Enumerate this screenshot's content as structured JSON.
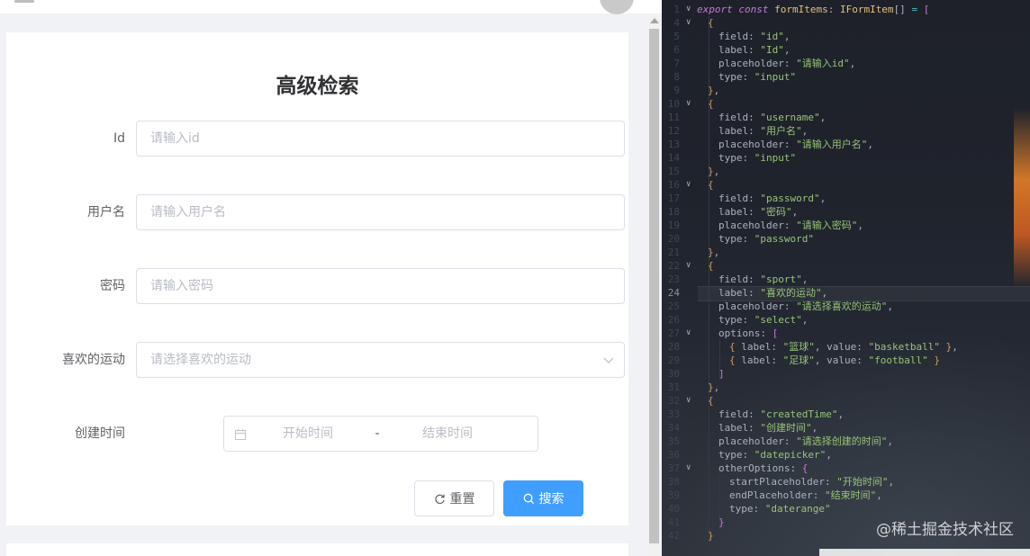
{
  "form": {
    "title": "高级检索",
    "fields": [
      {
        "label": "Id",
        "placeholder": "请输入id"
      },
      {
        "label": "用户名",
        "placeholder": "请输入用户名"
      },
      {
        "label": "密码",
        "placeholder": "请输入密码"
      },
      {
        "label": "喜欢的运动",
        "placeholder": "请选择喜欢的运动"
      },
      {
        "label": "创建时间",
        "start_placeholder": "开始时间",
        "separator": "-",
        "end_placeholder": "结束时间"
      }
    ],
    "reset_label": "重置",
    "search_label": "搜索"
  },
  "code": {
    "line_numbers": [
      "1",
      "4",
      "5",
      "6",
      "7",
      "8",
      "9",
      "10",
      "11",
      "12",
      "13",
      "14",
      "15",
      "16",
      "17",
      "18",
      "19",
      "20",
      "21",
      "22",
      "23",
      "24",
      "25",
      "26",
      "27",
      "28",
      "29",
      "30",
      "31",
      "32",
      "33",
      "34",
      "35",
      "36",
      "37",
      "38",
      "39",
      "40",
      "41",
      "42"
    ],
    "active_line": "24"
  },
  "watermark": "@稀土掘金技术社区",
  "colors": {
    "primary": "#409eff",
    "border": "#dcdfe6",
    "placeholder": "#b8bcc4",
    "label": "#606266",
    "code_bg": "#1e2129"
  }
}
